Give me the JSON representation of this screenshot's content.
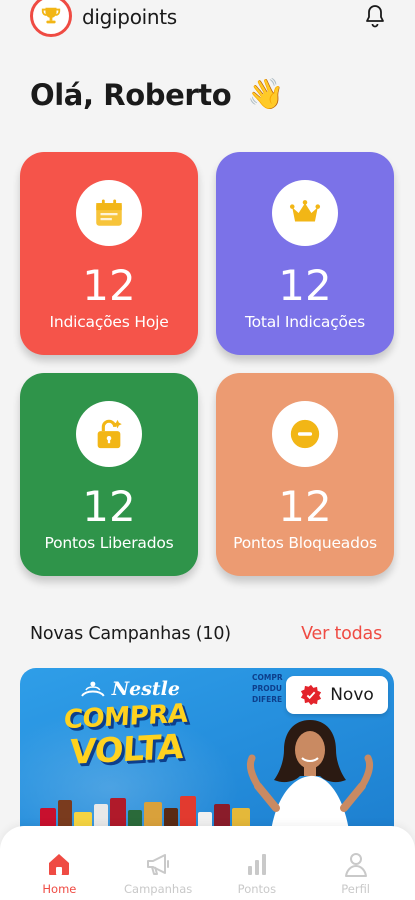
{
  "header": {
    "brand": "digipoints",
    "logo_icon": "trophy-icon",
    "notification_icon": "bell-icon"
  },
  "greeting": {
    "text": "Olá, Roberto",
    "emoji": "👋"
  },
  "stats": [
    {
      "icon": "calendar-icon",
      "value": "12",
      "label": "Indicações Hoje",
      "color": "#f5544a"
    },
    {
      "icon": "crown-icon",
      "value": "12",
      "label": "Total Indicações",
      "color": "#7b72e8"
    },
    {
      "icon": "unlock-icon",
      "value": "12",
      "label": "Pontos Liberados",
      "color": "#2f944a"
    },
    {
      "icon": "minus-circle-icon",
      "value": "12",
      "label": "Pontos Bloqueados",
      "color": "#ec9b72"
    }
  ],
  "campaigns": {
    "title": "Novas Campanhas (10)",
    "see_all": "Ver todas",
    "banner": {
      "brand": "Nestle",
      "headline_1": "COMPRA",
      "headline_2": "VOLTA",
      "small_text": "COMPR\nPRODU\nDIFERE",
      "badge": "Novo"
    }
  },
  "nav": [
    {
      "icon": "home-icon",
      "label": "Home",
      "active": true
    },
    {
      "icon": "megaphone-icon",
      "label": "Campanhas",
      "active": false
    },
    {
      "icon": "bar-chart-icon",
      "label": "Pontos",
      "active": false
    },
    {
      "icon": "user-icon",
      "label": "Perfil",
      "active": false
    }
  ],
  "colors": {
    "accent": "#ef4b43",
    "inactive_nav": "#c9c9c9"
  }
}
